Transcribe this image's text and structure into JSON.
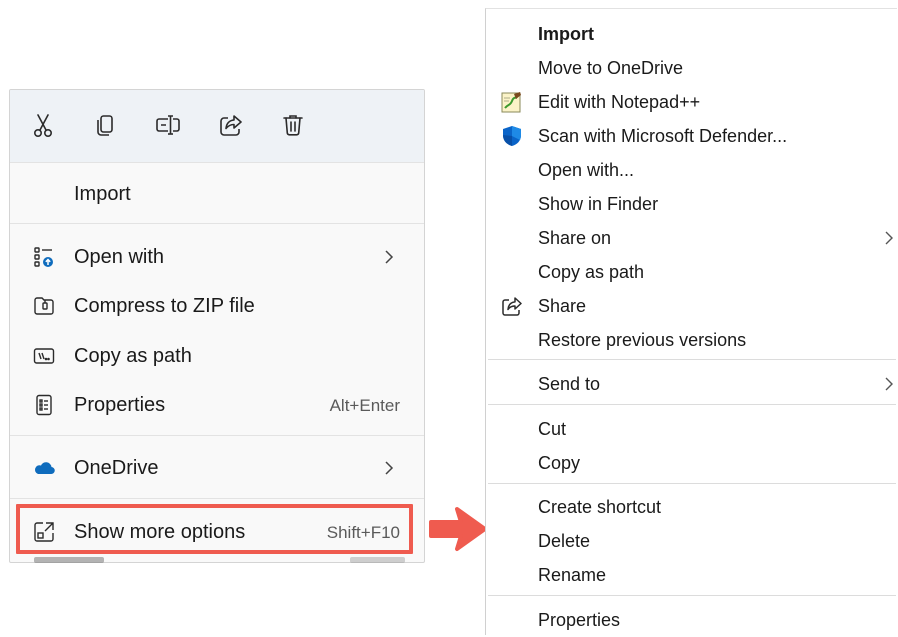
{
  "left_menu": {
    "toolbar": {
      "cut": "cut-icon",
      "copy": "copy-icon",
      "rename": "rename-icon",
      "share": "share-icon",
      "delete": "delete-icon"
    },
    "import_label": "Import",
    "items": [
      {
        "label": "Open with",
        "icon": "open-with-icon",
        "submenu": true
      },
      {
        "label": "Compress to ZIP file",
        "icon": "zip-icon"
      },
      {
        "label": "Copy as path",
        "icon": "copy-path-icon"
      },
      {
        "label": "Properties",
        "icon": "properties-icon",
        "shortcut": "Alt+Enter"
      }
    ],
    "onedrive_label": "OneDrive",
    "show_more": {
      "label": "Show more options",
      "shortcut": "Shift+F10"
    }
  },
  "right_menu": {
    "items": [
      {
        "label": "Import",
        "bold": true
      },
      {
        "label": "Move to OneDrive"
      },
      {
        "label": "Edit with Notepad++",
        "icon": "notepadpp-icon"
      },
      {
        "label": "Scan with Microsoft Defender...",
        "icon": "defender-shield-icon"
      },
      {
        "label": "Open with..."
      },
      {
        "label": "Show in Finder"
      },
      {
        "label": "Share on",
        "submenu": true
      },
      {
        "label": "Copy as path"
      },
      {
        "label": "Share",
        "icon": "share-icon"
      },
      {
        "label": "Restore previous versions"
      },
      {
        "label": "Send to",
        "submenu": true
      },
      {
        "label": "Cut"
      },
      {
        "label": "Copy"
      },
      {
        "label": "Create shortcut"
      },
      {
        "label": "Delete"
      },
      {
        "label": "Rename"
      },
      {
        "label": "Properties"
      }
    ]
  },
  "colors": {
    "highlight": "#ef5b4f",
    "toolbar_bg": "#eef2f6",
    "onedrive_blue": "#0f6cbd",
    "defender_blue": "#0a64c8"
  }
}
